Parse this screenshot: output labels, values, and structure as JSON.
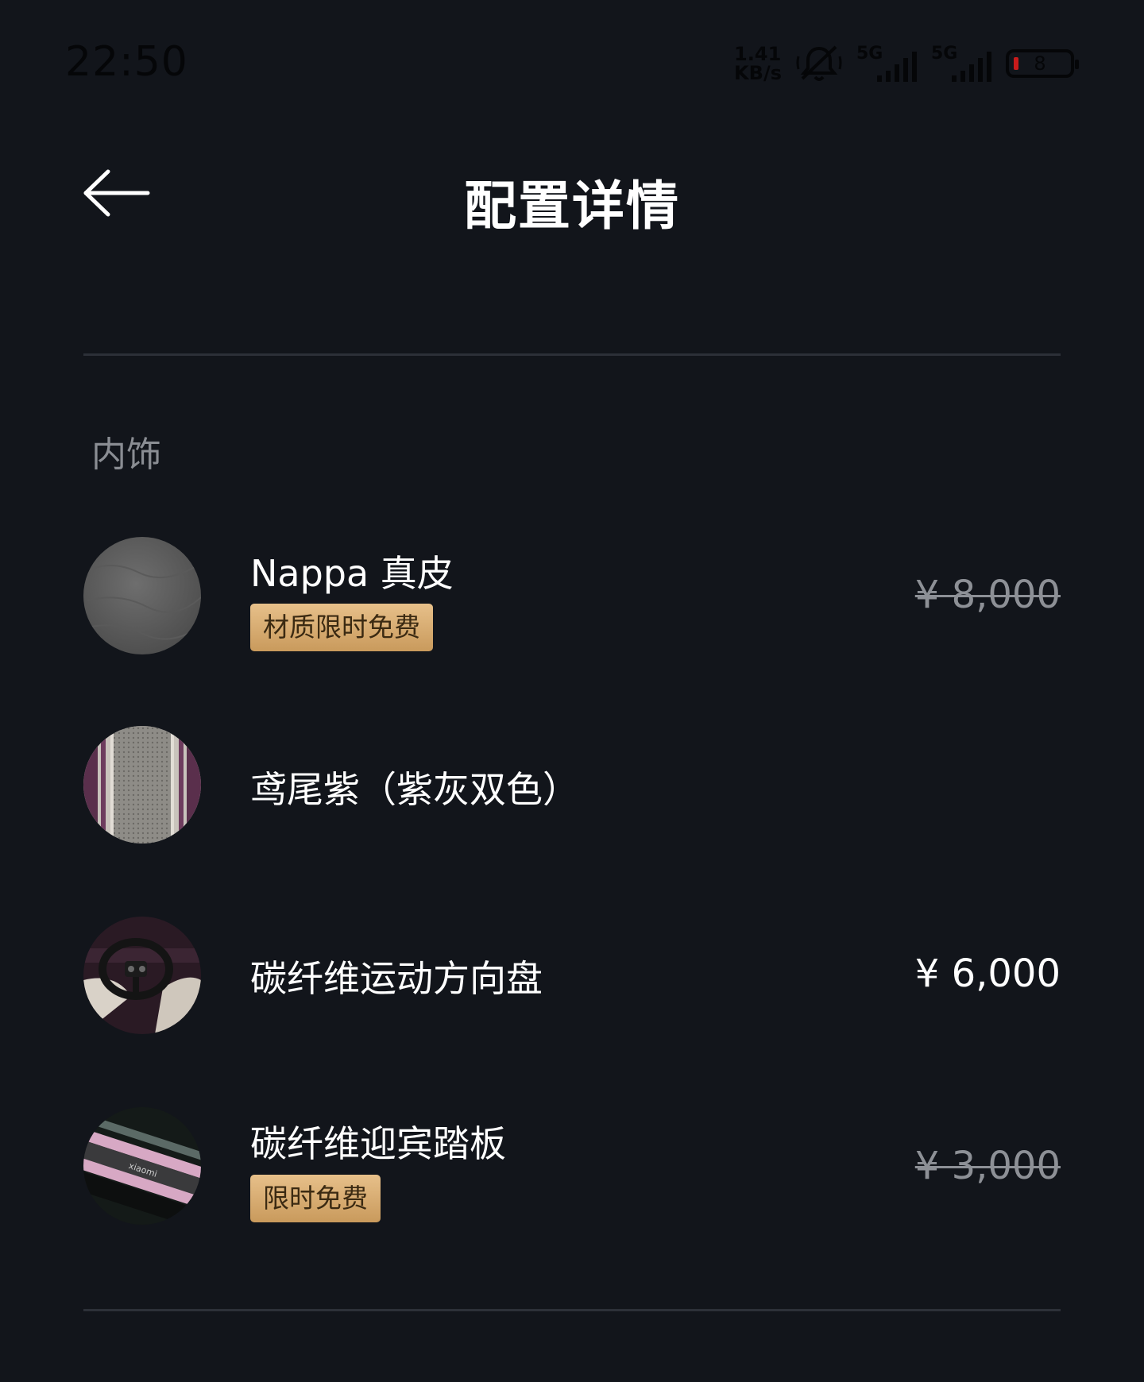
{
  "status_bar": {
    "time": "22:50",
    "net_speed_value": "1.41",
    "net_speed_unit": "KB/s",
    "sim1_label": "5G",
    "sim2_label": "5G",
    "battery_level": "8",
    "battery_color": "#c81b1b"
  },
  "header": {
    "title": "配置详情",
    "back_icon": "arrow-left-icon"
  },
  "section": {
    "title": "内饰"
  },
  "items": [
    {
      "name": "Nappa 真皮",
      "badge": "材质限时免费",
      "price": "¥ 8,000",
      "price_struck": true,
      "thumb": "gray-leather-swatch"
    },
    {
      "name": "鸢尾紫（紫灰双色）",
      "badge": "",
      "price": "",
      "price_struck": false,
      "thumb": "purple-gray-seat-swatch"
    },
    {
      "name": "碳纤维运动方向盘",
      "badge": "",
      "price": "¥ 6,000",
      "price_struck": false,
      "thumb": "steering-wheel-photo"
    },
    {
      "name": "碳纤维迎宾踏板",
      "badge": "限时免费",
      "price": "¥ 3,000",
      "price_struck": true,
      "thumb": "door-sill-plate-photo"
    }
  ],
  "colors": {
    "background": "#12151b",
    "badge_gold": "#d8ad73",
    "struck_price": "#8d9096",
    "section_title": "#8a8d93"
  }
}
